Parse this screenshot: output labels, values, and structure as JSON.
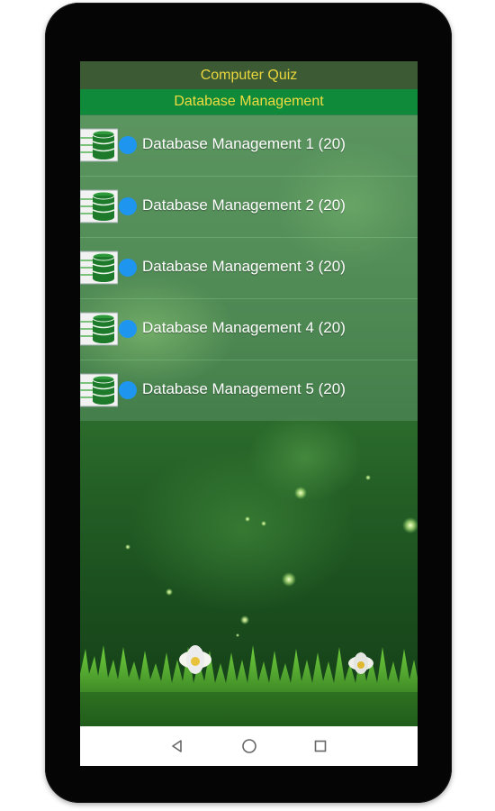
{
  "app": {
    "title": "Computer Quiz",
    "subtitle": "Database Management"
  },
  "list": {
    "items": [
      {
        "label": "Database Management 1 (20)",
        "icon": "database-table-icon"
      },
      {
        "label": "Database Management 2 (20)",
        "icon": "database-table-icon"
      },
      {
        "label": "Database Management 3 (20)",
        "icon": "database-table-icon"
      },
      {
        "label": "Database Management 4 (20)",
        "icon": "database-table-icon"
      },
      {
        "label": "Database Management 5 (20)",
        "icon": "database-table-icon"
      }
    ]
  },
  "nav": {
    "back_icon": "triangle-back-icon",
    "home_icon": "circle-home-icon",
    "recents_icon": "square-recents-icon"
  },
  "colors": {
    "title_text": "#e9d63c",
    "subtitle_bar": "#0f8a3a",
    "bullet": "#1e96f0",
    "db_cylinder": "#1c7a2a"
  }
}
